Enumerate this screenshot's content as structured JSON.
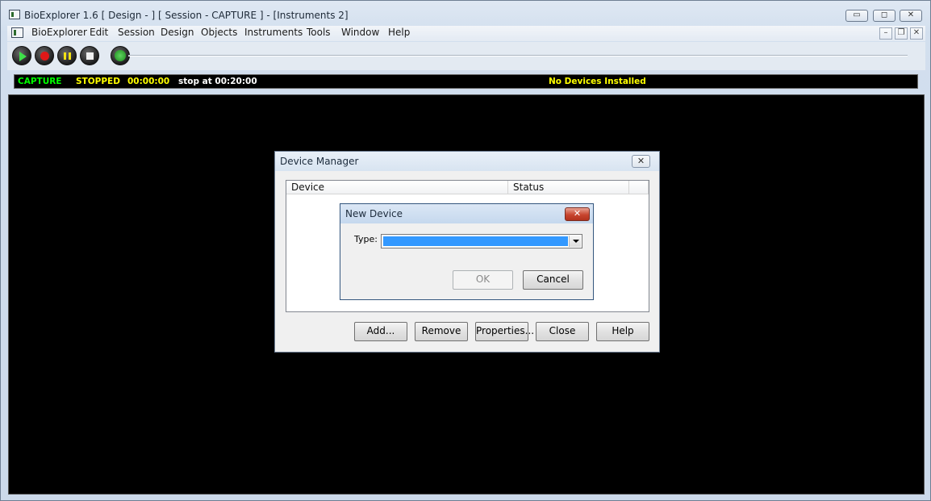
{
  "window": {
    "title": "BioExplorer 1.6  [ Design -  ] [ Session - CAPTURE ] - [Instruments 2]",
    "minimize": "▭",
    "maximize": "◻",
    "close": "✕"
  },
  "menu": {
    "items": [
      "BioExplorer",
      "Edit",
      "Session",
      "Design",
      "Objects",
      "Instruments",
      "Tools",
      "Window",
      "Help"
    ],
    "mdi_minimize": "–",
    "mdi_restore": "❐",
    "mdi_close": "✕"
  },
  "toolbar": {
    "buttons": [
      "play-icon",
      "record-icon",
      "pause-icon",
      "stop-icon",
      "monitor-icon"
    ]
  },
  "status": {
    "mode": "CAPTURE",
    "state": "STOPPED",
    "elapsed": "00:00:00",
    "stop_at": "stop at 00:20:00",
    "devices": "No Devices Installed",
    "colors": {
      "mode": "#00ff00",
      "state": "#ffff00",
      "elapsed": "#ffff00",
      "stop_at": "#ffffff",
      "devices": "#ffff00"
    }
  },
  "device_manager": {
    "title": "Device Manager",
    "close": "✕",
    "columns": [
      "Device",
      "Status"
    ],
    "buttons": {
      "add": "Add...",
      "remove": "Remove",
      "properties": "Properties...",
      "close": "Close",
      "help": "Help"
    }
  },
  "new_device": {
    "title": "New Device",
    "close": "✕",
    "type_label": "Type:",
    "type_value": "",
    "ok": "OK",
    "cancel": "Cancel"
  }
}
